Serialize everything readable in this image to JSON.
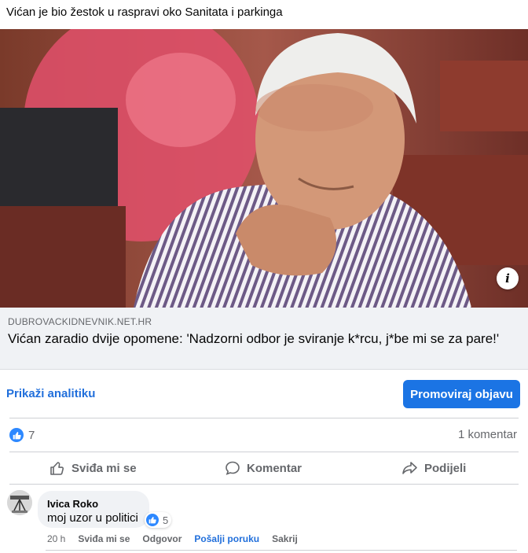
{
  "post": {
    "text": "Vićan je bio žestok u raspravi oko Sanitata i parkinga"
  },
  "link_preview": {
    "info_icon": "info-icon",
    "domain": "DUBROVACKIDNEVNIK.NET.HR",
    "title": "Vićan zaradio dvije opomene: 'Nadzorni odbor je sviranje k*rcu, j*be mi se za pare!'"
  },
  "toolbar": {
    "analytics_label": "Prikaži analitiku",
    "promote_label": "Promoviraj objavu"
  },
  "stats": {
    "reaction_icon": "like-icon",
    "reaction_count": "7",
    "comment_count": "1 komentar"
  },
  "actions": {
    "like_label": "Sviđa mi se",
    "comment_label": "Komentar",
    "share_label": "Podijeli"
  },
  "comment": {
    "author": "Ivica Roko",
    "text": "moj uzor u politici",
    "reaction_count": "5",
    "time": "20 h",
    "like_label": "Sviđa mi se",
    "reply_label": "Odgovor",
    "message_label": "Pošalji poruku",
    "hide_label": "Sakrij"
  },
  "colors": {
    "accent": "#1b74e4",
    "link_blue": "#216fdb",
    "secondary_text": "#65676b",
    "preview_bg": "#f0f2f5"
  }
}
